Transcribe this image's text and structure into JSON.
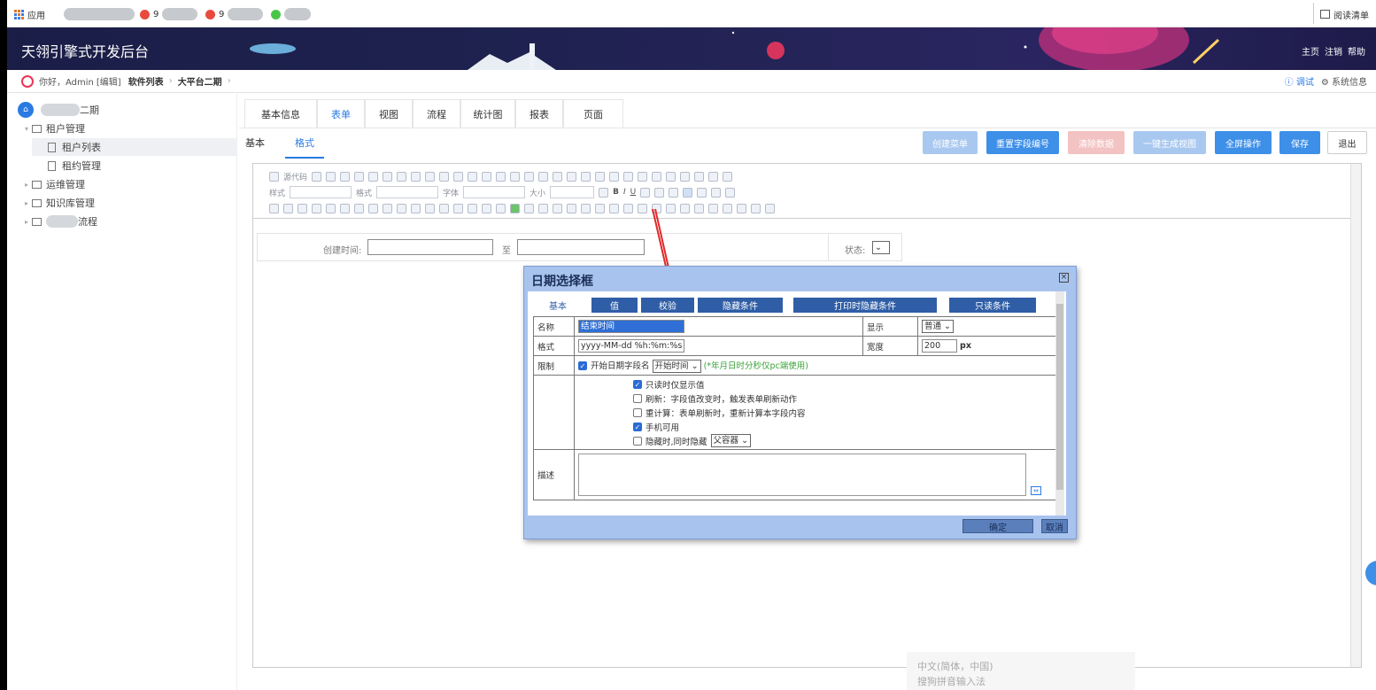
{
  "bookmarks": {
    "apps_label": "应用",
    "b2_label": "9",
    "b3_label": "9",
    "reading_list": "阅读清单"
  },
  "header": {
    "title": "天翎引擎式开发后台",
    "links": [
      "主页",
      "注销",
      "帮助"
    ]
  },
  "breadcrumb": {
    "greeting": "你好，Admin",
    "edit": "[编辑]",
    "items": [
      "软件列表",
      "大平台二期"
    ],
    "debug": "调试",
    "sysinfo": "系统信息"
  },
  "sidebar": {
    "root": "二期",
    "items": [
      {
        "label": "租户管理"
      },
      {
        "label": "租户列表"
      },
      {
        "label": "租约管理"
      },
      {
        "label": "运维管理"
      },
      {
        "label": "知识库管理"
      },
      {
        "label": "流程"
      }
    ]
  },
  "tabs": [
    "基本信息",
    "表单",
    "视图",
    "流程",
    "统计图",
    "报表",
    "页面"
  ],
  "subtabs": [
    "基本",
    "格式"
  ],
  "toolbar": {
    "buttons": [
      {
        "label": "创建菜单",
        "color": "#a8c8f0"
      },
      {
        "label": "重置字段编号",
        "color": "#3d8fe8"
      },
      {
        "label": "清除数据",
        "color": "#f3c2c2"
      },
      {
        "label": "一键生成视图",
        "color": "#a8c8f0"
      },
      {
        "label": "全屏操作",
        "color": "#3d8fe8"
      },
      {
        "label": "保存",
        "color": "#3d8fe8"
      },
      {
        "label": "退出",
        "color": "#ffffff"
      }
    ]
  },
  "editor": {
    "source_label": "源代码",
    "style_label": "样式",
    "format_label": "格式",
    "font_label": "字体",
    "size_label": "大小"
  },
  "form": {
    "create_time_label": "创建时间:",
    "to_label": "至",
    "status_label": "状态:"
  },
  "dialog": {
    "title": "日期选择框",
    "tabs": [
      "基本",
      "值",
      "校验",
      "隐藏条件",
      "打印时隐藏条件",
      "只读条件"
    ],
    "name_label": "名称",
    "name_value": "结束时间",
    "display_label": "显示",
    "display_value": "普通",
    "format_label": "格式",
    "format_value": "yyyy-MM-dd %h:%m:%s",
    "width_label": "宽度",
    "width_value": "200",
    "width_unit": "px",
    "limit_label": "限制",
    "limit_check": "开始日期字段名",
    "limit_select": "开始时间",
    "limit_note": "(*年月日时分秒仅pc端使用)",
    "options": [
      {
        "label": "只读时仅显示值",
        "checked": true
      },
      {
        "label": "刷新：字段值改变时，触发表单刷新动作",
        "checked": false
      },
      {
        "label": "重计算：表单刷新时，重新计算本字段内容",
        "checked": false
      },
      {
        "label": "手机可用",
        "checked": true
      },
      {
        "label": "隐藏时,同时隐藏",
        "checked": false
      }
    ],
    "hide_select": "父容器",
    "desc_label": "描述",
    "ok": "确定",
    "cancel": "取消"
  },
  "ime": {
    "line1": "中文(简体，中国)",
    "line2": "搜狗拼音输入法"
  },
  "colors": {
    "banner": "#1f2250",
    "accent": "#2a7ae2",
    "dialog_frame": "#a8c3ee"
  }
}
